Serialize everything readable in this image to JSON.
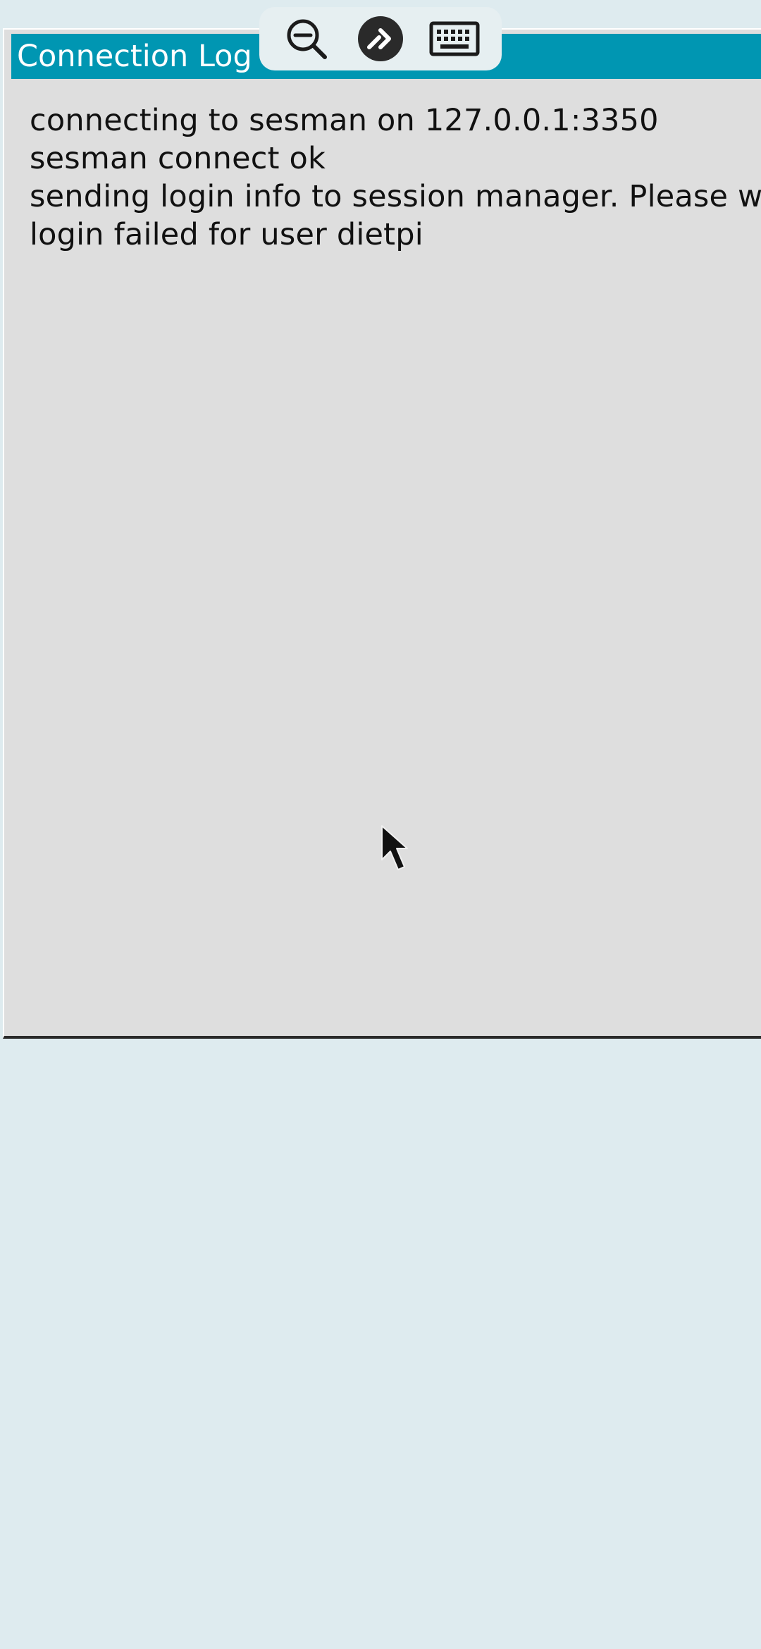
{
  "window": {
    "title": "Connection Log"
  },
  "log": {
    "lines": [
      "connecting to sesman on 127.0.0.1:3350",
      "sesman connect ok",
      "sending login info to session manager. Please wait...",
      "login failed for user dietpi"
    ]
  },
  "toolbar": {
    "zoom_icon": "zoom-out-icon",
    "remote_icon": "remote-desktop-icon",
    "keyboard_icon": "keyboard-icon"
  },
  "colors": {
    "background": "#deebef",
    "titlebar": "#0096b2",
    "window": "#dedede"
  }
}
